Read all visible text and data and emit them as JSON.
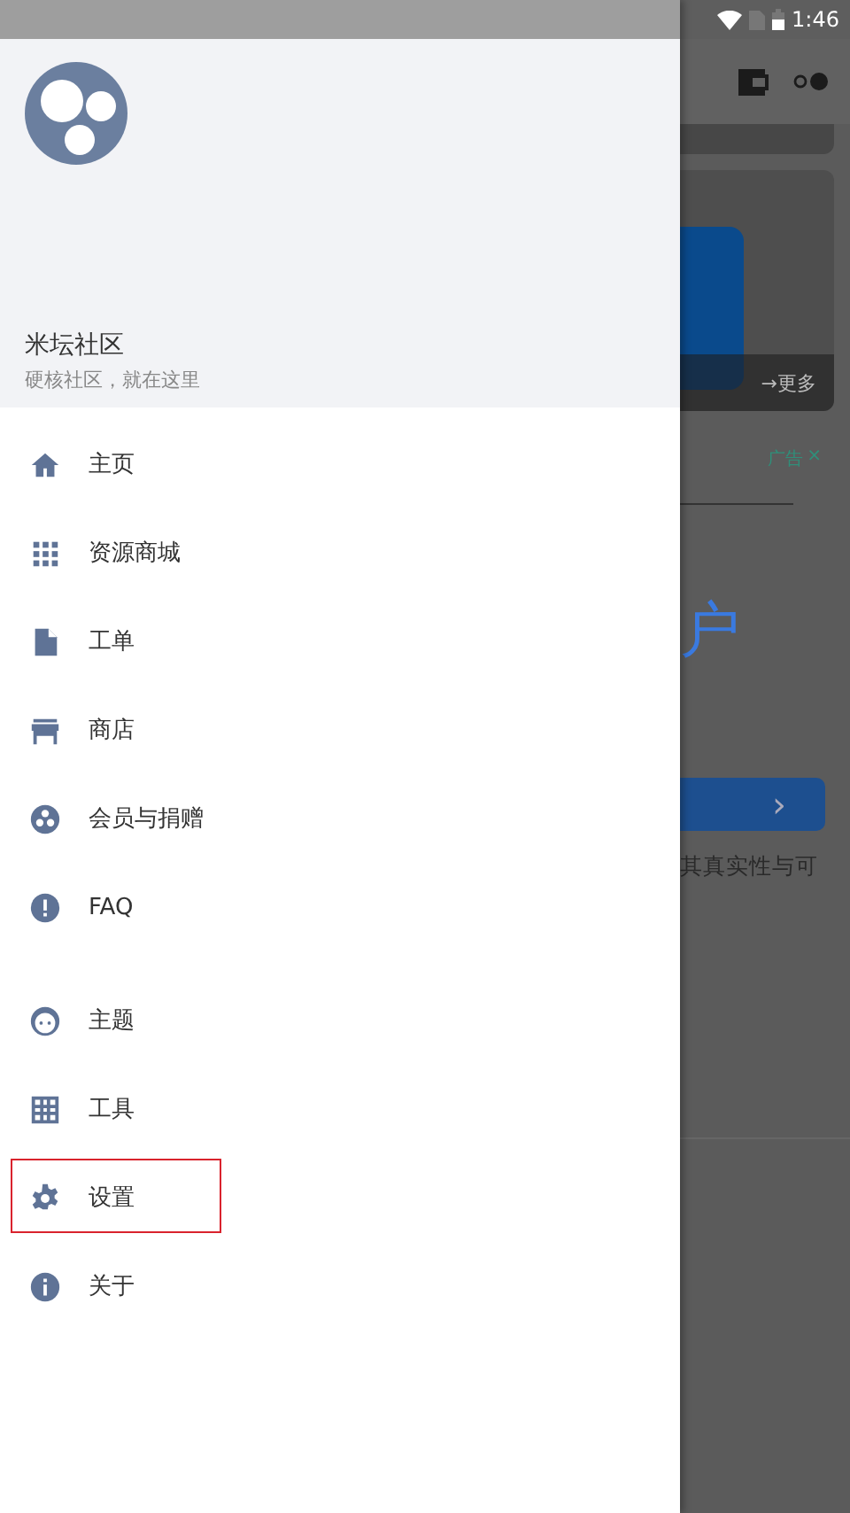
{
  "status_bar": {
    "time": "1:46"
  },
  "drawer": {
    "title": "米坛社区",
    "subtitle": "硬核社区，就在这里",
    "groups": [
      {
        "items": [
          {
            "kind": "home",
            "label": "主页",
            "highlighted": false
          },
          {
            "kind": "grid",
            "label": "资源商城",
            "highlighted": false
          },
          {
            "kind": "file",
            "label": "工单",
            "highlighted": false
          },
          {
            "kind": "store",
            "label": "商店",
            "highlighted": false
          },
          {
            "kind": "members",
            "label": "会员与捐赠",
            "highlighted": false
          },
          {
            "kind": "alert",
            "label": "FAQ",
            "highlighted": false
          }
        ]
      },
      {
        "items": [
          {
            "kind": "face",
            "label": "主题",
            "highlighted": false
          },
          {
            "kind": "table",
            "label": "工具",
            "highlighted": false
          },
          {
            "kind": "gear",
            "label": "设置",
            "highlighted": true
          },
          {
            "kind": "info",
            "label": "关于",
            "highlighted": false
          }
        ]
      }
    ]
  },
  "background": {
    "more_link": "→更多",
    "ad_label": "广告",
    "ad_close": "×",
    "ad_headline": "户",
    "ad_arrow": "›",
    "ad_text": "其真实性与可"
  }
}
